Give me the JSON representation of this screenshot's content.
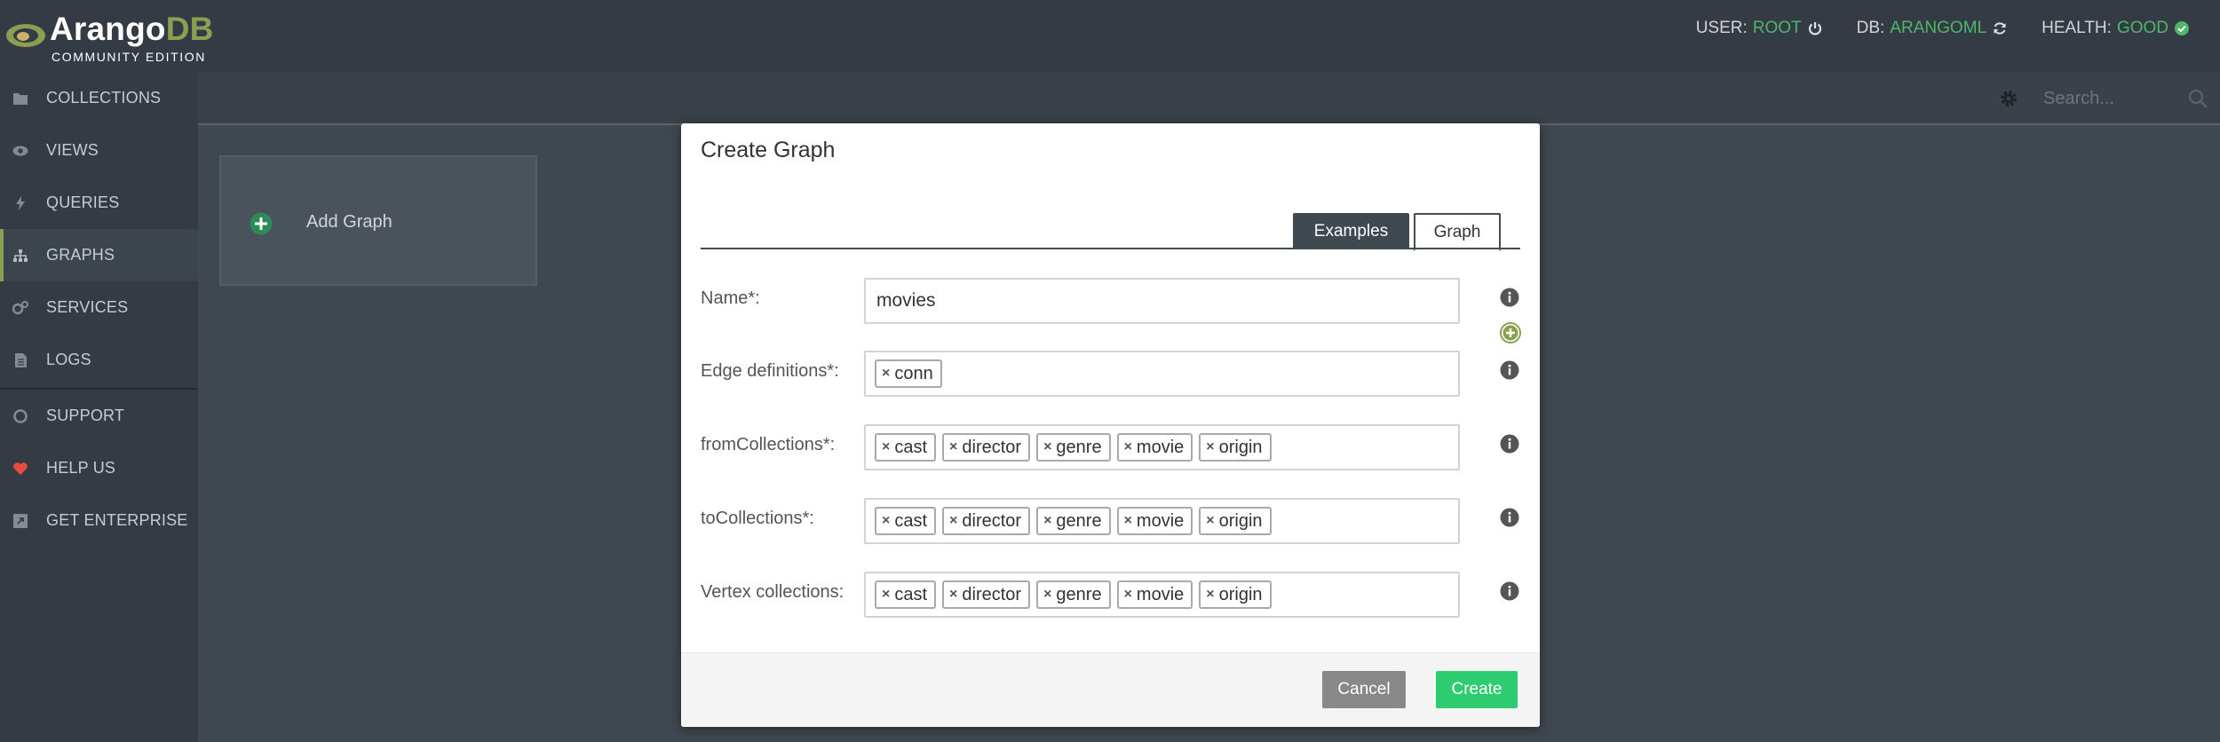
{
  "brand": {
    "name_a": "Arango",
    "name_b": "DB",
    "edition": "COMMUNITY EDITION"
  },
  "status": {
    "user_label": "USER:",
    "user_value": "ROOT",
    "db_label": "DB:",
    "db_value": "ARANGOML",
    "health_label": "HEALTH:",
    "health_value": "GOOD"
  },
  "sidebar": {
    "items": [
      {
        "label": "COLLECTIONS",
        "icon": "folder-icon"
      },
      {
        "label": "VIEWS",
        "icon": "eye-icon"
      },
      {
        "label": "QUERIES",
        "icon": "bolt-icon"
      },
      {
        "label": "GRAPHS",
        "icon": "sitemap-icon",
        "active": true
      },
      {
        "label": "SERVICES",
        "icon": "cogs-icon"
      },
      {
        "label": "LOGS",
        "icon": "file-icon"
      },
      {
        "label": "SUPPORT",
        "icon": "lifebuoy-icon"
      },
      {
        "label": "HELP US",
        "icon": "heart-icon"
      },
      {
        "label": "GET ENTERPRISE",
        "icon": "external-icon"
      }
    ]
  },
  "toolbar": {
    "search_placeholder": "Search..."
  },
  "add_graph": {
    "label": "Add Graph"
  },
  "modal": {
    "title": "Create Graph",
    "tabs": {
      "examples": "Examples",
      "graph": "Graph"
    },
    "name": {
      "label": "Name*:",
      "value": "movies"
    },
    "edge_definitions": {
      "label": "Edge definitions*:",
      "tags": [
        "conn"
      ]
    },
    "from_collections": {
      "label": "fromCollections*:",
      "tags": [
        "cast",
        "director",
        "genre",
        "movie",
        "origin"
      ]
    },
    "to_collections": {
      "label": "toCollections*:",
      "tags": [
        "cast",
        "director",
        "genre",
        "movie",
        "origin"
      ]
    },
    "vertex_collections": {
      "label": "Vertex collections:",
      "tags": [
        "cast",
        "director",
        "genre",
        "movie",
        "origin"
      ]
    },
    "buttons": {
      "cancel": "Cancel",
      "create": "Create"
    }
  },
  "colors": {
    "accent_green": "#4fb769",
    "brand_olive": "#8aa051",
    "create_button": "#2ecc71",
    "cancel_button": "#888888",
    "sidebar_bg": "#343b44"
  }
}
